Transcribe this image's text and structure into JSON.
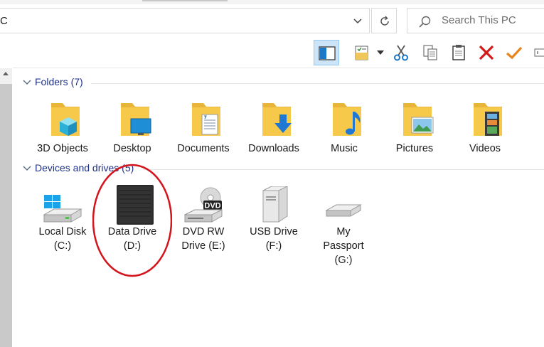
{
  "address": {
    "path_text": "C"
  },
  "search": {
    "placeholder": "Search This PC"
  },
  "groups": {
    "folders": {
      "title": "Folders (7)",
      "items": [
        {
          "label": "3D Objects",
          "icon": "3d-objects-folder-icon"
        },
        {
          "label": "Desktop",
          "icon": "desktop-folder-icon"
        },
        {
          "label": "Documents",
          "icon": "documents-folder-icon"
        },
        {
          "label": "Downloads",
          "icon": "downloads-folder-icon"
        },
        {
          "label": "Music",
          "icon": "music-folder-icon"
        },
        {
          "label": "Pictures",
          "icon": "pictures-folder-icon"
        },
        {
          "label": "Videos",
          "icon": "videos-folder-icon"
        }
      ]
    },
    "devices": {
      "title": "Devices and drives (5)",
      "items": [
        {
          "line1": "Local Disk",
          "line2": "(C:)",
          "line3": "",
          "icon": "local-disk-icon"
        },
        {
          "line1": "Data Drive",
          "line2": "(D:)",
          "line3": "",
          "icon": "external-hdd-icon"
        },
        {
          "line1": "DVD RW",
          "line2": "Drive (E:)",
          "line3": "",
          "icon": "dvd-drive-icon",
          "badge": "DVD"
        },
        {
          "line1": "USB Drive",
          "line2": "(F:)",
          "line3": "",
          "icon": "usb-drive-icon"
        },
        {
          "line1": "My",
          "line2": "Passport",
          "line3": "(G:)",
          "icon": "portable-drive-icon"
        }
      ]
    }
  },
  "toolbar": [
    "preview-pane-icon",
    "properties-icon",
    "dropdown-arrow-icon",
    "cut-icon",
    "copy-icon",
    "paste-icon",
    "delete-icon",
    "checkmark-icon",
    "rename-icon"
  ],
  "colors": {
    "accent": "#0078d7",
    "header_text": "#1e3287",
    "annotation": "#d4141c",
    "folder": "#f6c94b"
  }
}
